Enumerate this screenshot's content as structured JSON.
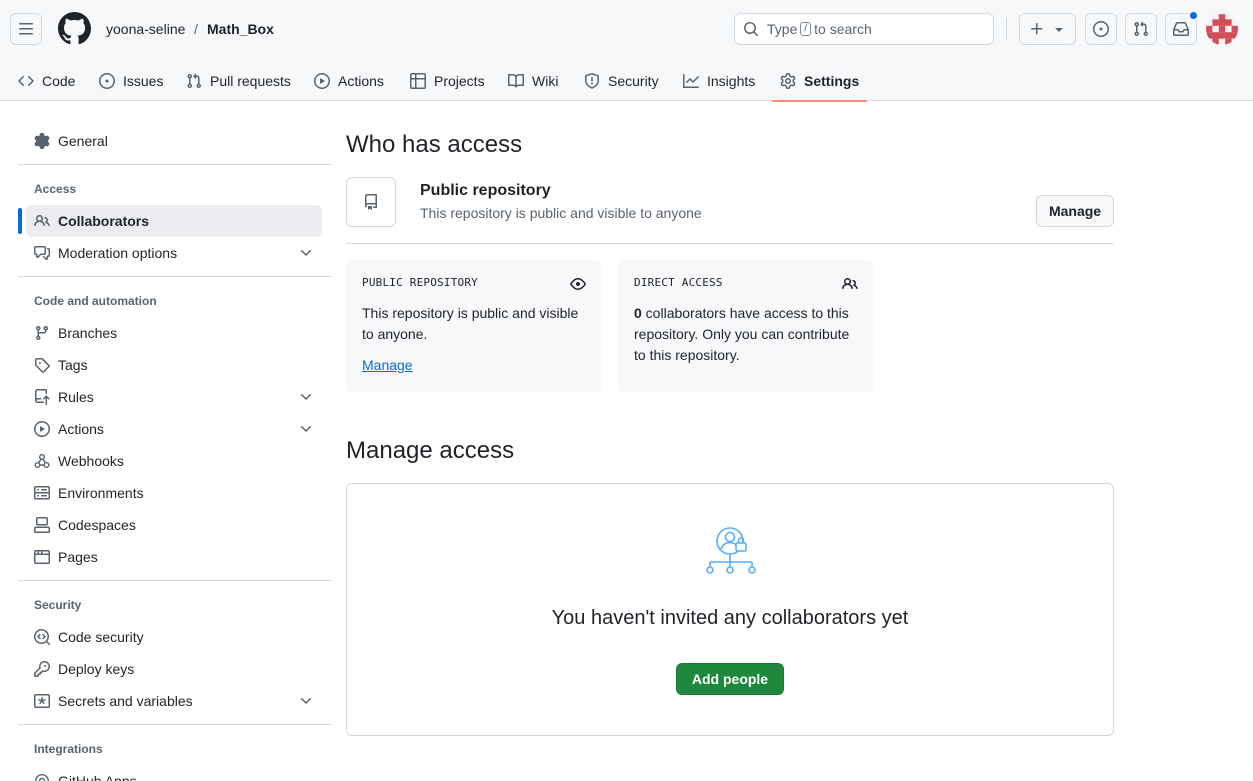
{
  "header": {
    "owner": "yoona-seline",
    "separator": "/",
    "repo": "Math_Box",
    "search": {
      "prefix": "Type",
      "key": "/",
      "suffix": "to search"
    },
    "notification_dot_color": "#0969da"
  },
  "tabs": [
    {
      "label": "Code",
      "icon": "code-icon"
    },
    {
      "label": "Issues",
      "icon": "issue-opened-icon"
    },
    {
      "label": "Pull requests",
      "icon": "git-pull-request-icon"
    },
    {
      "label": "Actions",
      "icon": "play-icon"
    },
    {
      "label": "Projects",
      "icon": "table-icon"
    },
    {
      "label": "Wiki",
      "icon": "book-icon"
    },
    {
      "label": "Security",
      "icon": "shield-icon"
    },
    {
      "label": "Insights",
      "icon": "graph-icon"
    },
    {
      "label": "Settings",
      "icon": "gear-icon",
      "active": true
    }
  ],
  "sidebar": {
    "general": "General",
    "access_heading": "Access",
    "access": [
      "Collaborators",
      "Moderation options"
    ],
    "code_heading": "Code and automation",
    "code": [
      "Branches",
      "Tags",
      "Rules",
      "Actions",
      "Webhooks",
      "Environments",
      "Codespaces",
      "Pages"
    ],
    "security_heading": "Security",
    "security": [
      "Code security",
      "Deploy keys",
      "Secrets and variables"
    ],
    "integrations_heading": "Integrations",
    "integrations": [
      "GitHub Apps"
    ]
  },
  "who": {
    "title": "Who has access",
    "repo_title": "Public repository",
    "repo_desc": "This repository is public and visible to anyone",
    "manage_button": "Manage"
  },
  "cards": {
    "public": {
      "label": "PUBLIC REPOSITORY",
      "line1": "This repository is public and visible",
      "line2": "to anyone.",
      "link": "Manage"
    },
    "direct": {
      "label": "DIRECT ACCESS",
      "count": "0",
      "line1": " collaborators have access to this",
      "line2": "repository. Only you can contribute",
      "line3": "to this repository."
    }
  },
  "manage": {
    "title": "Manage access",
    "empty_title": "You haven't invited any collaborators yet",
    "add_button": "Add people"
  },
  "colors": {
    "accent": "#0969da",
    "primary": "#1f883d",
    "tab_underline": "#fd8c73"
  }
}
